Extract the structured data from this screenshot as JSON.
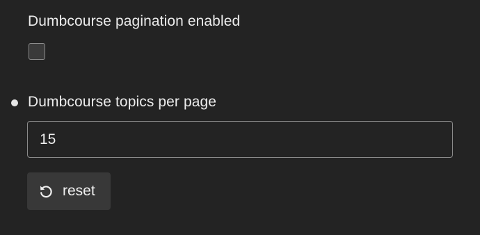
{
  "settings": {
    "pagination": {
      "label": "Dumbcourse pagination enabled",
      "checked": false
    },
    "topics_per_page": {
      "label": "Dumbcourse topics per page",
      "value": "15",
      "overridden_indicator": "dot-indicator"
    }
  },
  "reset_button": {
    "label": "reset",
    "icon": "undo-icon"
  },
  "colors": {
    "background": "#232323",
    "text": "#ececec",
    "input_border": "#8a8a8a",
    "button_background": "#383838"
  }
}
